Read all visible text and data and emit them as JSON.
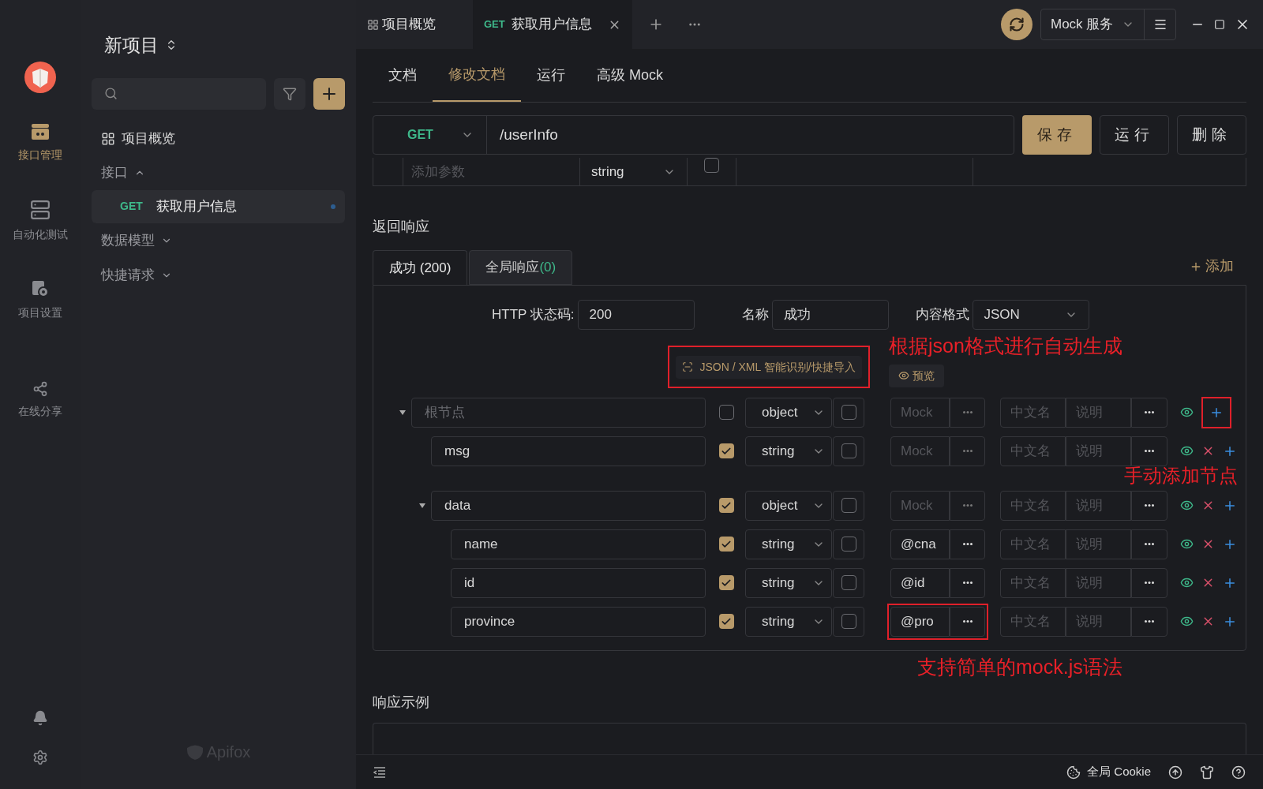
{
  "rail": {
    "items": [
      {
        "kind": "api",
        "label": "接口管理",
        "selected": true
      },
      {
        "kind": "auto",
        "label": "自动化测试",
        "selected": false
      },
      {
        "kind": "settings",
        "label": "项目设置",
        "selected": false
      },
      {
        "kind": "share",
        "label": "在线分享",
        "selected": false
      }
    ],
    "brand": "Apifox"
  },
  "sidebar": {
    "project": "新项目",
    "items": [
      {
        "kind": "overview",
        "label": "项目概览"
      },
      {
        "kind": "group",
        "label": "接口",
        "expanded": true,
        "children": [
          {
            "method": "GET",
            "label": "获取用户信息",
            "selected": true
          }
        ]
      },
      {
        "kind": "group",
        "label": "数据模型",
        "expanded": false
      },
      {
        "kind": "group",
        "label": "快捷请求",
        "expanded": false
      }
    ]
  },
  "tabs": [
    {
      "kind": "overview",
      "label": "项目概览",
      "selected": false
    },
    {
      "kind": "api",
      "method": "GET",
      "label": "获取用户信息",
      "selected": true
    }
  ],
  "mock_service": "Mock 服务",
  "subtabs": [
    {
      "label": "文档",
      "selected": false
    },
    {
      "label": "修改文档",
      "selected": true
    },
    {
      "label": "运行",
      "selected": false
    },
    {
      "label": "高级 Mock",
      "selected": false
    }
  ],
  "request": {
    "method": "GET",
    "path": "/userInfo",
    "buttons": [
      {
        "label": "保存",
        "primary": true
      },
      {
        "label": "运行",
        "primary": false
      },
      {
        "label": "删除",
        "primary": false
      }
    ]
  },
  "param_row": {
    "placeholder": "添加参数",
    "type": "string",
    "checked": false
  },
  "response": {
    "title": "返回响应",
    "tabs": [
      {
        "label": "成功 (200)",
        "selected": true
      },
      {
        "label": "全局响应",
        "count": "(0)",
        "selected": false
      }
    ],
    "add": "添加",
    "status_label": "HTTP 状态码:",
    "status": "200",
    "name_label": "名称",
    "name": "成功",
    "format_label": "内容格式",
    "format": "JSON",
    "import": "JSON / XML 智能识别/快捷导入",
    "preview": "预览",
    "tree": [
      {
        "placeholder": "根节点",
        "required": false,
        "type": "object",
        "nullable": false,
        "mock_placeholder": "Mock",
        "cn_placeholder": "中文名",
        "desc_placeholder": "说明",
        "deletable": false,
        "expanded": true,
        "children": [
          {
            "deletable": true,
            "name": "msg",
            "required": true,
            "type": "string",
            "nullable": false,
            "mock_placeholder": "Mock",
            "cn_placeholder": "中文名",
            "desc_placeholder": "说明"
          },
          {
            "deletable": true,
            "name": "data",
            "required": true,
            "type": "object",
            "nullable": false,
            "mock_placeholder": "Mock",
            "cn_placeholder": "中文名",
            "desc_placeholder": "说明",
            "expanded": true,
            "children": [
              {
                "deletable": true,
                "name": "name",
                "required": true,
                "type": "string",
                "nullable": false,
                "mock": "@cna",
                "cn_placeholder": "中文名",
                "desc_placeholder": "说明"
              },
              {
                "deletable": true,
                "name": "id",
                "required": true,
                "type": "string",
                "nullable": false,
                "mock": "@id",
                "cn_placeholder": "中文名",
                "desc_placeholder": "说明"
              },
              {
                "deletable": true,
                "name": "province",
                "required": true,
                "type": "string",
                "nullable": false,
                "mock": "@pro",
                "cn_placeholder": "中文名",
                "desc_placeholder": "说明"
              }
            ]
          }
        ]
      }
    ]
  },
  "annotations": {
    "import": "根据json格式进行自动生成",
    "add": "手动添加节点",
    "mock": "支持简单的mock.js语法"
  },
  "example": {
    "title": "响应示例"
  },
  "status_bar": {
    "cookie": "全局 Cookie"
  }
}
